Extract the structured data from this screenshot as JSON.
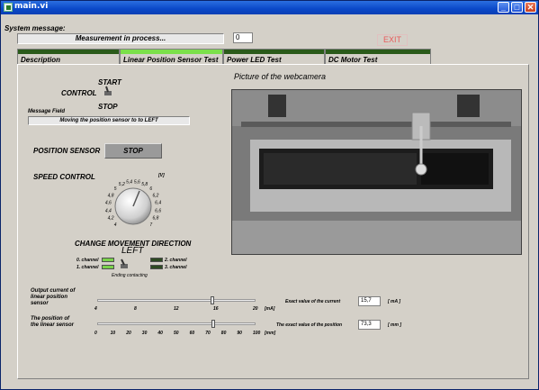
{
  "window": {
    "title": "main.vi"
  },
  "system_message": {
    "label": "System message:",
    "value": "Measurement in process...",
    "counter": "0"
  },
  "exit_label": "EXIT",
  "tabs": [
    {
      "label": "Description",
      "active": false
    },
    {
      "label": "Linear Position Sensor Test",
      "active": true
    },
    {
      "label": "Power LED Test",
      "active": false
    },
    {
      "label": "DC Motor Test",
      "active": false
    }
  ],
  "control": {
    "label": "CONTROL",
    "start": "START",
    "stop": "STOP"
  },
  "message_field": {
    "label": "Message Field",
    "value": "Moving the position sensor to to LEFT"
  },
  "position_sensor": {
    "label": "POSITION SENSOR",
    "button": "STOP"
  },
  "speed_control": {
    "label": "SPEED CONTROL",
    "unit": "[V]",
    "ticks": [
      "4",
      "4,2",
      "4,4",
      "4,6",
      "4,8",
      "5",
      "5,2",
      "5,4",
      "5,6",
      "5,8",
      "6",
      "6,2",
      "6,4",
      "6,6",
      "6,8",
      "7"
    ]
  },
  "camera": {
    "label": "Picture of the webcamera"
  },
  "direction": {
    "label": "CHANGE MOVEMENT DIRECTION",
    "value": "LEFT",
    "channels": [
      {
        "label": "0. channel",
        "state": "on"
      },
      {
        "label": "1. channel",
        "state": "on"
      },
      {
        "label": "2. channel",
        "state": "off"
      },
      {
        "label": "3. channel",
        "state": "off"
      }
    ],
    "ending": "Ending contacting"
  },
  "current": {
    "label_l1": "Output current of",
    "label_l2": "linear position",
    "label_l3": "sensor",
    "ticks": [
      "4",
      "8",
      "12",
      "16",
      "20"
    ],
    "unit": "[mA]",
    "exact_label": "Exact value of the current",
    "exact_value": "15,7",
    "exact_unit": "[ mA ]",
    "slider_fraction": 0.73
  },
  "position": {
    "label_l1": "The position of",
    "label_l2": "the linear sensor",
    "ticks": [
      "0",
      "10",
      "20",
      "30",
      "40",
      "50",
      "60",
      "70",
      "80",
      "90",
      "100"
    ],
    "unit": "[mm]",
    "exact_label": "The exact value of the position",
    "exact_value": "73,3",
    "exact_unit": "[ mm ]",
    "slider_fraction": 0.733
  }
}
